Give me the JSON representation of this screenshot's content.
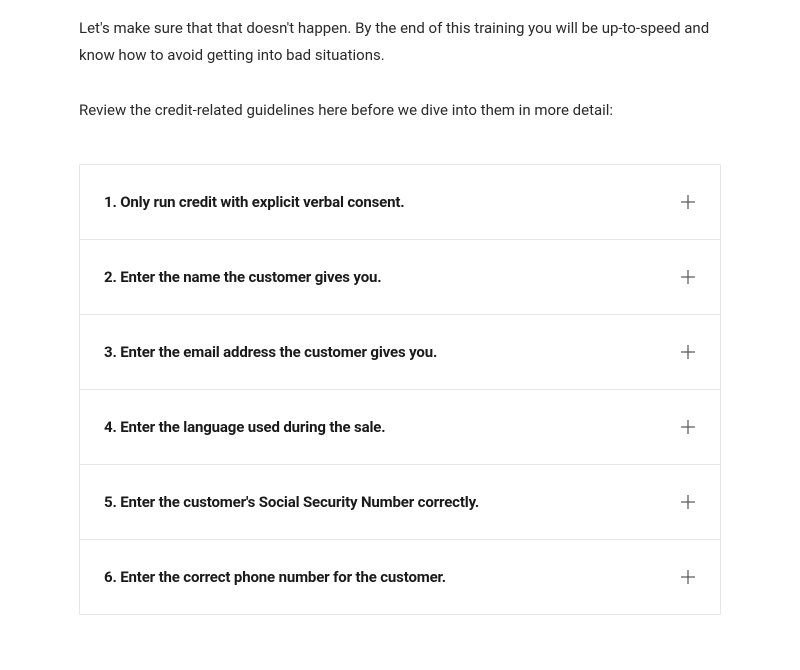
{
  "intro": {
    "paragraph1": "Let's make sure that that doesn't happen. By the end of this training you will be up-to-speed and know how to avoid getting into bad situations.",
    "paragraph2": "Review the credit-related guidelines here before we dive into them in more detail:"
  },
  "accordion": {
    "items": [
      {
        "label": "1. Only run credit with explicit verbal consent."
      },
      {
        "label": "2. Enter the name the customer gives you."
      },
      {
        "label": "3. Enter the email address the customer gives you."
      },
      {
        "label": "4. Enter the language used during the sale."
      },
      {
        "label": "5. Enter the customer's Social Security Number correctly."
      },
      {
        "label": "6. Enter the correct phone number for the customer."
      }
    ]
  }
}
